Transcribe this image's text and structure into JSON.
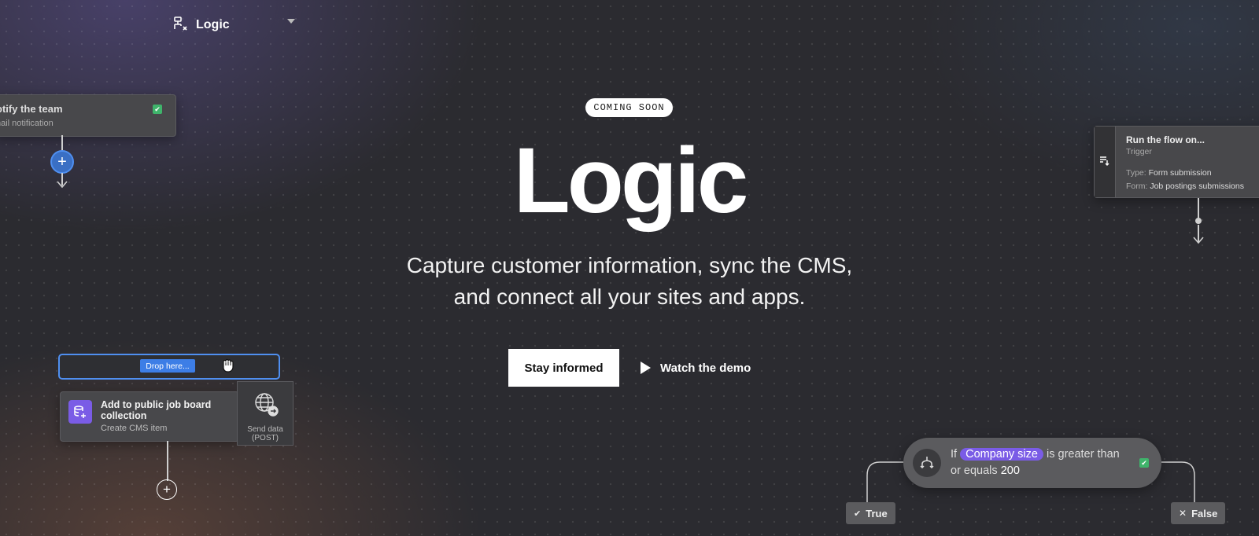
{
  "hero": {
    "badge": "COMING SOON",
    "title": "Logic",
    "subtitle": "Capture customer information, sync the CMS, and connect all your sites and apps.",
    "primary_button": "Stay informed",
    "demo_button": "Watch the demo"
  },
  "logic_select": {
    "label": "Logic"
  },
  "notify_card": {
    "title": "otify the team",
    "subtitle": "nail notification"
  },
  "drop_zone": {
    "label": "Drop here..."
  },
  "cms_card": {
    "title": "Add to public job board collection",
    "subtitle": "Create CMS item"
  },
  "send_card": {
    "label": "Send data (POST)"
  },
  "trigger_card": {
    "title": "Run the flow on...",
    "subtitle": "Trigger",
    "type_label": "Type:",
    "type_value": "Form submission",
    "form_label": "Form:",
    "form_value": "Job postings submissions"
  },
  "condition": {
    "if_word": "If",
    "field": "Company size",
    "operator": "is greater than or equals",
    "value": "200",
    "true_label": "True",
    "false_label": "False"
  },
  "colors": {
    "accent_blue": "#3d7ee6",
    "accent_purple": "#7a5ce6",
    "success_green": "#3fb46b"
  }
}
